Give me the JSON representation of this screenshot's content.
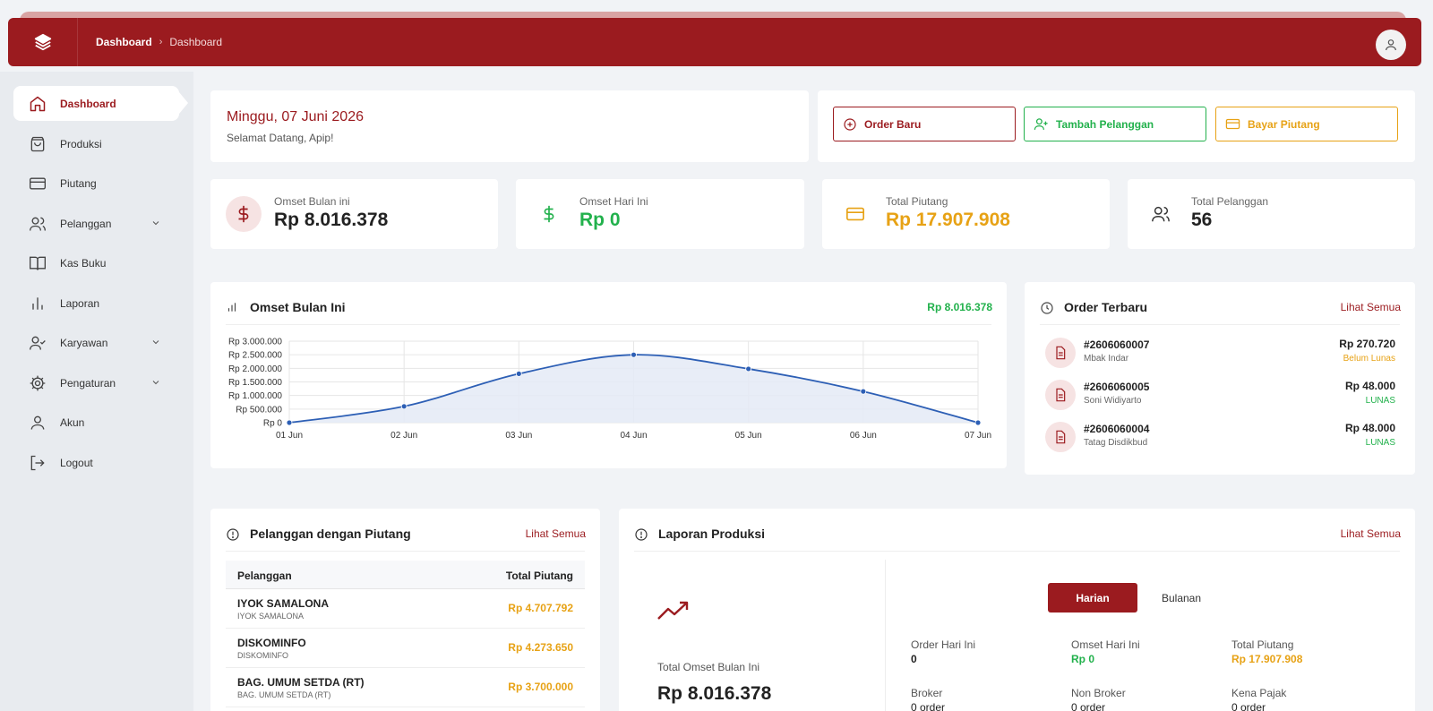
{
  "topbar": {
    "breadcrumb_root": "Dashboard",
    "breadcrumb_current": "Dashboard"
  },
  "sidebar": {
    "items": [
      {
        "label": "Dashboard",
        "icon": "home-icon",
        "active": true
      },
      {
        "label": "Produksi",
        "icon": "shopping-bag-icon"
      },
      {
        "label": "Piutang",
        "icon": "credit-card-icon"
      },
      {
        "label": "Pelanggan",
        "icon": "users-icon",
        "expandable": true
      },
      {
        "label": "Kas Buku",
        "icon": "book-open-icon"
      },
      {
        "label": "Laporan",
        "icon": "bar-chart-icon"
      },
      {
        "label": "Karyawan",
        "icon": "user-check-icon",
        "expandable": true
      },
      {
        "label": "Pengaturan",
        "icon": "gear-icon",
        "expandable": true
      },
      {
        "label": "Akun",
        "icon": "user-icon"
      },
      {
        "label": "Logout",
        "icon": "logout-icon"
      }
    ]
  },
  "welcome": {
    "date": "Minggu, 07 Juni 2026",
    "greeting": "Selamat Datang, Apip!"
  },
  "quick_actions": {
    "order_baru": "Order Baru",
    "tambah_pelanggan": "Tambah Pelanggan",
    "bayar_piutang": "Bayar Piutang"
  },
  "stats": [
    {
      "label": "Omset Bulan ini",
      "value": "Rp 8.016.378",
      "color": "#222222"
    },
    {
      "label": "Omset Hari Ini",
      "value": "Rp 0",
      "color": "#22b14c"
    },
    {
      "label": "Total Piutang",
      "value": "Rp 17.907.908",
      "color": "#e7a215"
    },
    {
      "label": "Total Pelanggan",
      "value": "56",
      "color": "#222222"
    }
  ],
  "omset_card": {
    "title": "Omset Bulan Ini",
    "total": "Rp 8.016.378"
  },
  "chart_data": {
    "type": "area",
    "categories": [
      "01 Jun",
      "02 Jun",
      "03 Jun",
      "04 Jun",
      "05 Jun",
      "06 Jun",
      "07 Jun"
    ],
    "values": [
      0,
      600000,
      1800000,
      2500000,
      1980000,
      1150000,
      0
    ],
    "ylim": [
      0,
      3000000
    ],
    "yticks": [
      {
        "value": 3000000,
        "label": "Rp 3.000.000"
      },
      {
        "value": 2500000,
        "label": "Rp 2.500.000"
      },
      {
        "value": 2000000,
        "label": "Rp 2.000.000"
      },
      {
        "value": 1500000,
        "label": "Rp 1.500.000"
      },
      {
        "value": 1000000,
        "label": "Rp 1.000.000"
      },
      {
        "value": 500000,
        "label": "Rp 500.000"
      },
      {
        "value": 0,
        "label": "Rp 0"
      }
    ],
    "grid": true,
    "line_color": "#2d5fb5",
    "fill_color": "#e4eaf6"
  },
  "orders": {
    "title": "Order Terbaru",
    "link": "Lihat Semua",
    "items": [
      {
        "id": "#2606060007",
        "name": "Mbak Indar",
        "amount": "Rp 270.720",
        "status": "Belum Lunas",
        "status_color": "#e7a215"
      },
      {
        "id": "#2606060005",
        "name": "Soni Widiyarto",
        "amount": "Rp 48.000",
        "status": "LUNAS",
        "status_color": "#22b14c"
      },
      {
        "id": "#2606060004",
        "name": "Tatag Disdikbud",
        "amount": "Rp 48.000",
        "status": "LUNAS",
        "status_color": "#22b14c"
      }
    ]
  },
  "debtors": {
    "title": "Pelanggan dengan Piutang",
    "link": "Lihat Semua",
    "col_customer": "Pelanggan",
    "col_total": "Total Piutang",
    "rows": [
      {
        "name": "IYOK SAMALONA",
        "sub": "IYOK SAMALONA",
        "amount": "Rp 4.707.792"
      },
      {
        "name": "DISKOMINFO",
        "sub": "DISKOMINFO",
        "amount": "Rp 4.273.650"
      },
      {
        "name": "BAG. UMUM SETDA (RT)",
        "sub": "BAG. UMUM SETDA (RT)",
        "amount": "Rp 3.700.000"
      }
    ]
  },
  "production": {
    "title": "Laporan Produksi",
    "link": "Lihat Semua",
    "total_label": "Total Omset Bulan Ini",
    "total_value": "Rp 8.016.378",
    "tab_daily": "Harian",
    "tab_monthly": "Bulanan",
    "metrics": [
      {
        "label": "Order Hari Ini",
        "value": "0",
        "color": "#222222"
      },
      {
        "label": "Omset Hari Ini",
        "value": "Rp 0",
        "color": "#22b14c"
      },
      {
        "label": "Total Piutang",
        "value": "Rp 17.907.908",
        "color": "#e7a215"
      },
      {
        "label": "Broker",
        "value": "0 order",
        "color": "#222222"
      },
      {
        "label": "Non Broker",
        "value": "0 order",
        "color": "#222222"
      },
      {
        "label": "Kena Pajak",
        "value": "0 order",
        "color": "#222222"
      }
    ]
  },
  "colors": {
    "brand": "#9b1b1f",
    "success": "#22b14c",
    "warning": "#e7a215"
  }
}
